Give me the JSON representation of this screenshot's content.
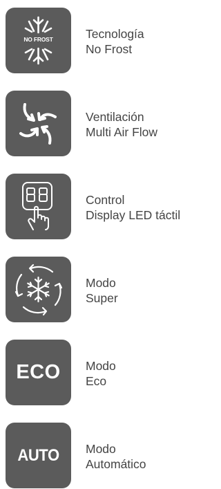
{
  "colors": {
    "tile": "#5b5b5b",
    "icon": "#ffffff",
    "text": "#444444"
  },
  "features": [
    {
      "icon": "snowflake-no-frost-icon",
      "badge": "NO FROST",
      "line1": "Tecnología",
      "line2": "No Frost"
    },
    {
      "icon": "air-flow-arrows-icon",
      "line1": "Ventilación",
      "line2": "Multi Air Flow"
    },
    {
      "icon": "touch-led-display-icon",
      "line1": "Control",
      "line2": "Display LED táctil"
    },
    {
      "icon": "super-cooling-snowflake-icon",
      "line1": "Modo",
      "line2": "Super"
    },
    {
      "icon": "eco-mode-icon",
      "badge": "ECO",
      "line1": "Modo",
      "line2": "Eco"
    },
    {
      "icon": "auto-mode-icon",
      "badge": "AUTO",
      "line1": "Modo",
      "line2": "Automático"
    }
  ]
}
